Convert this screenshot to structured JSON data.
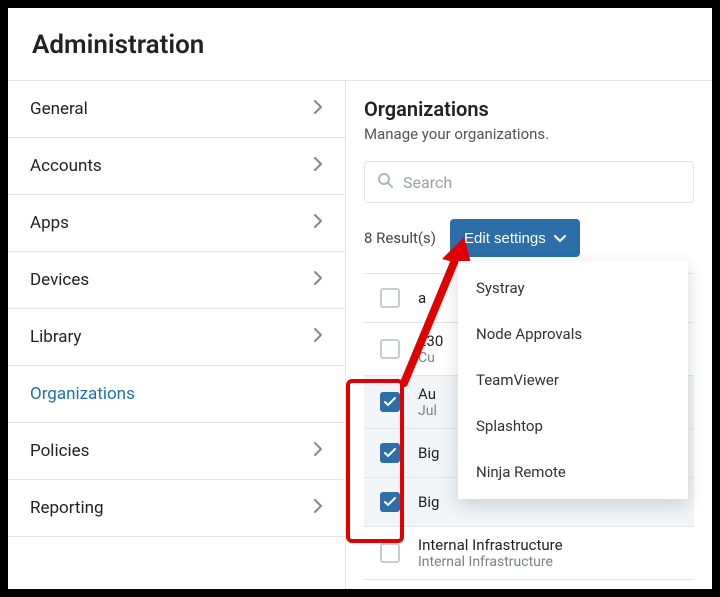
{
  "header": {
    "title": "Administration"
  },
  "sidebar": {
    "items": [
      {
        "label": "General"
      },
      {
        "label": "Accounts"
      },
      {
        "label": "Apps"
      },
      {
        "label": "Devices"
      },
      {
        "label": "Library"
      },
      {
        "label": "Organizations",
        "active": true
      },
      {
        "label": "Policies"
      },
      {
        "label": "Reporting"
      }
    ]
  },
  "main": {
    "heading": "Organizations",
    "subtitle": "Manage your organizations.",
    "search_placeholder": "Search",
    "results_label": "8 Result(s)",
    "edit_button": "Edit settings",
    "dropdown": [
      "Systray",
      "Node Approvals",
      "TeamViewer",
      "Splashtop",
      "Ninja Remote"
    ],
    "rows": [
      {
        "checked": false,
        "title": "a",
        "sub": ""
      },
      {
        "checked": false,
        "title": "230",
        "sub": "Cu"
      },
      {
        "checked": true,
        "title": "Au",
        "sub": "Jul"
      },
      {
        "checked": true,
        "title": "Big",
        "sub": ""
      },
      {
        "checked": true,
        "title": "Big",
        "sub": ""
      },
      {
        "checked": false,
        "title": "Internal Infrastructure",
        "sub": "Internal Infrastructure"
      }
    ]
  },
  "colors": {
    "primary": "#2b6ea8",
    "annotation": "#e10000"
  }
}
